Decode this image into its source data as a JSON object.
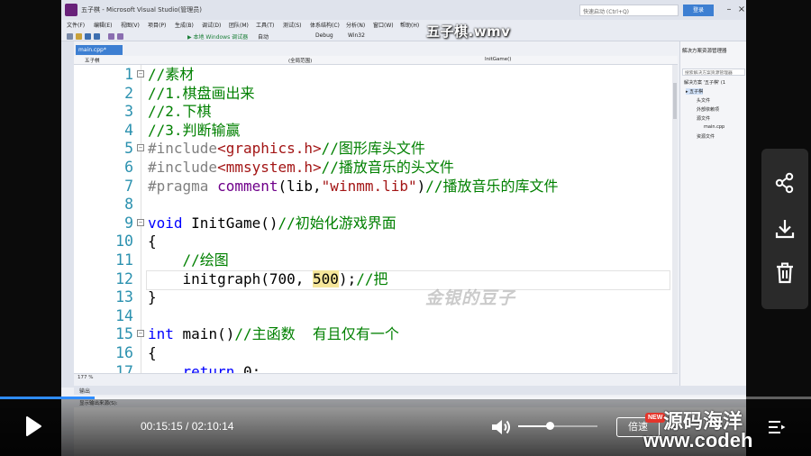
{
  "vs": {
    "window_title": "五子棋 - Microsoft Visual Studio(管理员)",
    "search_placeholder": "快速启动 (Ctrl+Q)",
    "login": "登录",
    "menus": [
      "文件(F)",
      "编辑(E)",
      "视图(V)",
      "项目(P)",
      "生成(B)",
      "调试(D)",
      "团队(M)",
      "工具(T)",
      "测试(S)",
      "体系结构(C)",
      "分析(N)",
      "窗口(W)",
      "帮助(H)"
    ],
    "toolbar": {
      "debugger": "▶ 本地 Windows 调试器",
      "auto": "自动",
      "config": "Debug",
      "platform": "Win32"
    },
    "doc_tab": "main.cpp*",
    "nav": {
      "project": "五子棋",
      "scope": "(全局范围)",
      "member": "InitGame()"
    },
    "zoom": "177 %",
    "output_title": "输出",
    "output_source_label": "显示输出来源(S):"
  },
  "video": {
    "title": "五子棋.wmv",
    "watermark": "金银的豆子"
  },
  "code_lines": [
    {
      "num": "1",
      "fold": "⊟",
      "parts": [
        {
          "t": "//素材",
          "c": "c-cm"
        }
      ]
    },
    {
      "num": "2",
      "fold": "",
      "parts": [
        {
          "t": "//1.棋盘画出来",
          "c": "c-cm"
        }
      ]
    },
    {
      "num": "3",
      "fold": "",
      "parts": [
        {
          "t": "//2.下棋",
          "c": "c-cm"
        }
      ]
    },
    {
      "num": "4",
      "fold": "",
      "parts": [
        {
          "t": "//3.判断输赢",
          "c": "c-cm"
        }
      ]
    },
    {
      "num": "5",
      "fold": "⊟",
      "parts": [
        {
          "t": "#include",
          "c": "c-pp"
        },
        {
          "t": "<graphics.h>",
          "c": "c-hd"
        },
        {
          "t": "//图形库头文件",
          "c": "c-cm"
        }
      ]
    },
    {
      "num": "6",
      "fold": "",
      "parts": [
        {
          "t": "#include",
          "c": "c-pp"
        },
        {
          "t": "<mmsystem.h>",
          "c": "c-hd"
        },
        {
          "t": "//播放音乐的头文件",
          "c": "c-cm"
        }
      ]
    },
    {
      "num": "7",
      "fold": "",
      "parts": [
        {
          "t": "#pragma",
          "c": "c-pp"
        },
        {
          "t": " comment",
          "c": "c-pr"
        },
        {
          "t": "(lib,",
          "c": ""
        },
        {
          "t": "\"winmm.lib\"",
          "c": "c-str"
        },
        {
          "t": ")",
          "c": ""
        },
        {
          "t": "//播放音乐的库文件",
          "c": "c-cm"
        }
      ]
    },
    {
      "num": "8",
      "fold": "",
      "parts": []
    },
    {
      "num": "9",
      "fold": "⊟",
      "parts": [
        {
          "t": "void",
          "c": "c-kw"
        },
        {
          "t": " InitGame()",
          "c": ""
        },
        {
          "t": "//初始化游戏界面",
          "c": "c-cm"
        }
      ]
    },
    {
      "num": "10",
      "fold": "",
      "parts": [
        {
          "t": "{",
          "c": ""
        }
      ]
    },
    {
      "num": "11",
      "fold": "",
      "parts": [
        {
          "t": "    //绘图",
          "c": "c-cm"
        }
      ]
    },
    {
      "num": "12",
      "fold": "",
      "parts": [
        {
          "t": "    initgraph(700, ",
          "c": ""
        },
        {
          "t": "500",
          "c": "sel"
        },
        {
          "t": ");",
          "c": ""
        },
        {
          "t": "//把",
          "c": "c-cm"
        }
      ]
    },
    {
      "num": "13",
      "fold": "",
      "parts": [
        {
          "t": "}",
          "c": ""
        }
      ]
    },
    {
      "num": "14",
      "fold": "",
      "parts": []
    },
    {
      "num": "15",
      "fold": "⊟",
      "parts": [
        {
          "t": "int",
          "c": "c-kw"
        },
        {
          "t": " main()",
          "c": ""
        },
        {
          "t": "//主函数  有且仅有一个",
          "c": "c-cm"
        }
      ]
    },
    {
      "num": "16",
      "fold": "",
      "parts": [
        {
          "t": "{",
          "c": ""
        }
      ]
    },
    {
      "num": "17",
      "fold": "",
      "parts": [
        {
          "t": "    return",
          "c": "c-kw"
        },
        {
          "t": " 0;",
          "c": ""
        }
      ]
    }
  ],
  "solution": {
    "panel_title": "解决方案资源管理器",
    "search_placeholder": "搜索解决方案资源管理器",
    "items": [
      {
        "label": "解决方案 '五子棋' (1",
        "sel": false
      },
      {
        "label": "▸ 五子棋",
        "sel": true
      },
      {
        "label": "头文件",
        "sel": false
      },
      {
        "label": "外部依赖项",
        "sel": false
      },
      {
        "label": "源文件",
        "sel": false
      },
      {
        "label": "main.cpp",
        "sel": false
      },
      {
        "label": "资源文件",
        "sel": false
      }
    ]
  },
  "player": {
    "current_time": "00:15:15",
    "total_time": "02:10:14",
    "time_text": "00:15:15 / 02:10:14",
    "progress": 0.117,
    "volume": 0.4,
    "speed_label": "倍速",
    "new_badge": "NEW",
    "brand_line1": "源码海洋",
    "brand_line2": "www.codeh"
  },
  "icons": {
    "play": "play-icon",
    "volume": "volume-icon",
    "share": "share-icon",
    "download": "download-icon",
    "delete": "trash-icon",
    "playlist": "playlist-icon"
  },
  "colors": {
    "accent": "#2e8cff",
    "vs_blue": "#3d7fd2",
    "comment": "#008000",
    "keyword": "#0000ff",
    "line_number": "#2b91af",
    "selection": "#f5e69a",
    "new_badge": "#e5352b"
  }
}
